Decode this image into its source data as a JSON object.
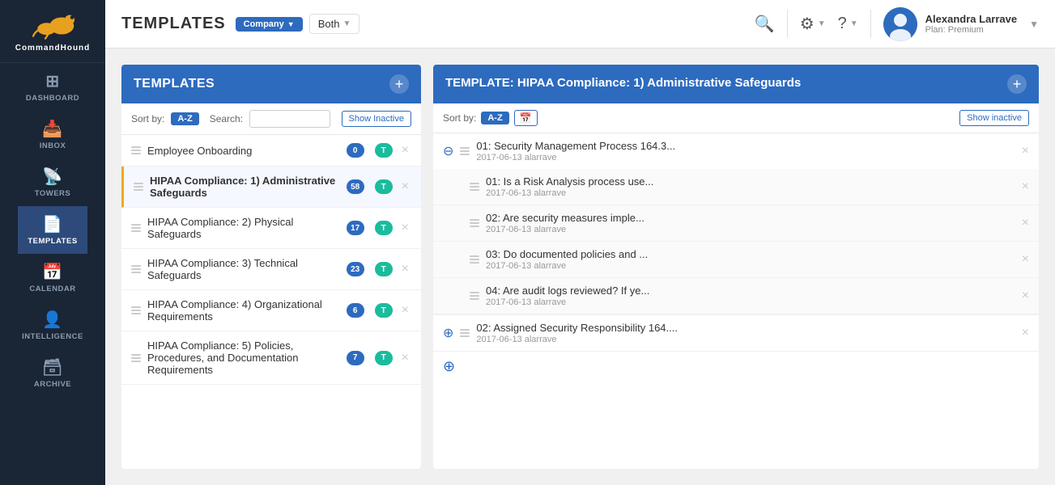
{
  "app": {
    "name": "CommandHound"
  },
  "topbar": {
    "title": "TEMPLATES",
    "company_badge": "Company",
    "both_label": "Both",
    "search_icon": "🔍",
    "settings_icon": "⚙",
    "help_icon": "?",
    "user": {
      "name": "Alexandra Larrave",
      "plan": "Plan: Premium"
    }
  },
  "sidebar": {
    "items": [
      {
        "id": "dashboard",
        "label": "DASHBOARD",
        "icon": "⊞",
        "active": false
      },
      {
        "id": "inbox",
        "label": "INBOX",
        "icon": "📥",
        "active": false
      },
      {
        "id": "towers",
        "label": "TOWERS",
        "icon": "📡",
        "active": false
      },
      {
        "id": "templates",
        "label": "TEMPLATES",
        "icon": "📄",
        "active": true
      },
      {
        "id": "calendar",
        "label": "CALENDAR",
        "icon": "📅",
        "active": false
      },
      {
        "id": "intelligence",
        "label": "INTELLIGENCE",
        "icon": "👤",
        "active": false
      },
      {
        "id": "archive",
        "label": "ARCHIVE",
        "icon": "🗃",
        "active": false
      }
    ]
  },
  "templates_panel": {
    "header": "TEMPLATES",
    "sort_label": "Sort by:",
    "sort_btn": "A-Z",
    "search_label": "Search:",
    "search_placeholder": "",
    "show_inactive": "Show Inactive",
    "items": [
      {
        "name": "Employee Onboarding",
        "badge_num": "0",
        "badge_type": "T",
        "selected": false
      },
      {
        "name": "HIPAA Compliance: 1) Administrative Safeguards",
        "badge_num": "58",
        "badge_type": "T",
        "selected": true
      },
      {
        "name": "HIPAA Compliance: 2) Physical Safeguards",
        "badge_num": "17",
        "badge_type": "T",
        "selected": false
      },
      {
        "name": "HIPAA Compliance: 3) Technical Safeguards",
        "badge_num": "23",
        "badge_type": "T",
        "selected": false
      },
      {
        "name": "HIPAA Compliance: 4) Organizational Requirements",
        "badge_num": "6",
        "badge_type": "T",
        "selected": false
      },
      {
        "name": "HIPAA Compliance: 5) Policies, Procedures, and Documentation Requirements",
        "badge_num": "7",
        "badge_type": "T",
        "selected": false
      }
    ]
  },
  "detail_panel": {
    "header": "TEMPLATE: HIPAA Compliance: 1) Administrative Safeguards",
    "sort_btn": "A-Z",
    "calendar_btn": "📅",
    "show_inactive": "Show inactive",
    "sections": [
      {
        "title": "01: Security Management Process 164.3...",
        "expanded": true,
        "date": "2017-06-13",
        "user": "alarrave",
        "sub_items": [
          {
            "title": "01: Is a Risk Analysis process use...",
            "date": "2017-06-13",
            "user": "alarrave"
          },
          {
            "title": "02: Are security measures imple...",
            "date": "2017-06-13",
            "user": "alarrave"
          },
          {
            "title": "03: Do documented policies and ...",
            "date": "2017-06-13",
            "user": "alarrave"
          },
          {
            "title": "04: Are audit logs reviewed? If ye...",
            "date": "2017-06-13",
            "user": "alarrave"
          }
        ]
      },
      {
        "title": "02: Assigned Security Responsibility 164....",
        "expanded": false,
        "date": "2017-06-13",
        "user": "alarrave",
        "sub_items": []
      }
    ]
  }
}
